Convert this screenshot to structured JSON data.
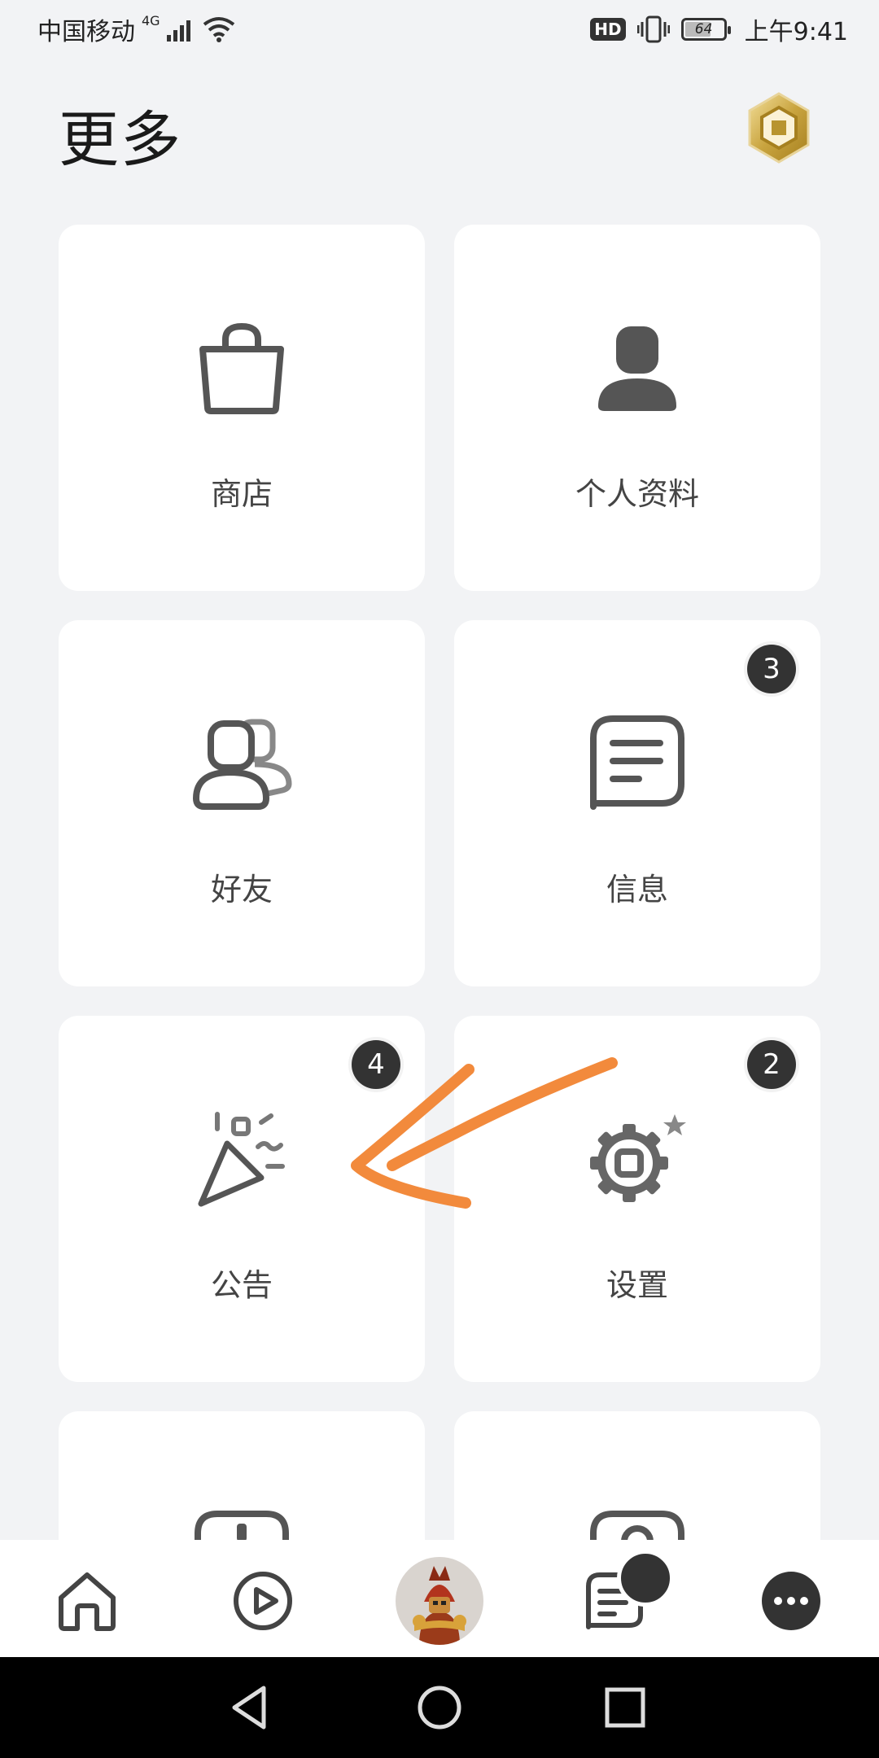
{
  "status_bar": {
    "carrier": "中国移动",
    "network": "4G",
    "hd": "HD",
    "battery": "64",
    "time": "上午9:41"
  },
  "header": {
    "title": "更多"
  },
  "tiles": [
    {
      "label": "商店",
      "icon": "shopping-bag-icon"
    },
    {
      "label": "个人资料",
      "icon": "person-icon"
    },
    {
      "label": "好友",
      "icon": "friends-icon",
      "badge": null
    },
    {
      "label": "信息",
      "icon": "message-icon",
      "badge": "3"
    },
    {
      "label": "公告",
      "icon": "party-popper-icon",
      "badge": "4"
    },
    {
      "label": "设置",
      "icon": "gear-icon",
      "badge": "2"
    }
  ],
  "bottom_nav": [
    {
      "name": "home",
      "icon": "home-icon"
    },
    {
      "name": "play",
      "icon": "play-icon"
    },
    {
      "name": "avatar",
      "icon": "avatar-icon"
    },
    {
      "name": "chat",
      "icon": "chat-icon"
    },
    {
      "name": "more",
      "icon": "more-icon"
    }
  ],
  "colors": {
    "background": "#f2f3f5",
    "card": "#ffffff",
    "badge": "#333333",
    "annotation": "#f28a3c"
  }
}
